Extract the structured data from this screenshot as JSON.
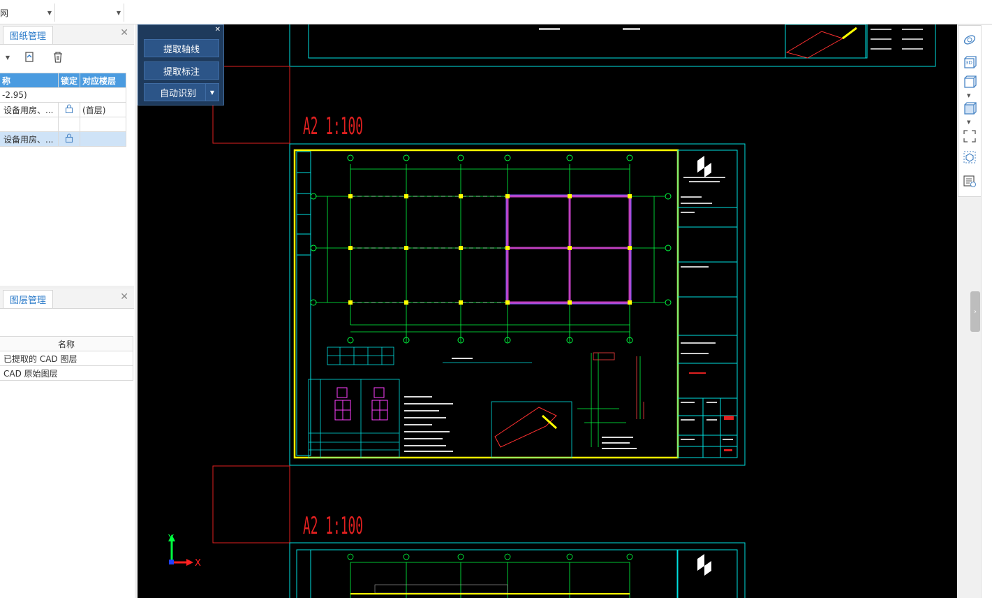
{
  "topbar": {
    "combo1": "网",
    "combo2": ""
  },
  "drawing_panel": {
    "tab": "图纸管理",
    "columns": [
      "称",
      "锁定",
      "对应楼层"
    ],
    "rows": [
      {
        "name": "-2.95)",
        "lock": "",
        "floor": ""
      },
      {
        "name": "设备用房、...",
        "lock": "lock-icon",
        "floor": "(首层)"
      },
      {
        "name": "",
        "lock": "",
        "floor": ""
      },
      {
        "name": "设备用房、...",
        "lock": "lock-icon",
        "floor": ""
      }
    ]
  },
  "layer_panel": {
    "tab": "图层管理",
    "column": "名称",
    "rows": [
      "已提取的 CAD 图层",
      "CAD 原始图层"
    ]
  },
  "float_panel": {
    "buttons": [
      "提取轴线",
      "提取标注",
      "自动识别"
    ]
  },
  "canvas": {
    "sheet_label_1": "A2 1:100",
    "sheet_label_2": "A2 1:100",
    "axis_y": "Y",
    "axis_x": "X"
  },
  "right_toolbar": {
    "tool_3d": "3D"
  },
  "colors": {
    "accent": "#2a7ac9",
    "header": "#4a9be0",
    "cad_cyan": "#00ffff",
    "cad_yellow": "#ffff00",
    "cad_red": "#ff0000"
  }
}
